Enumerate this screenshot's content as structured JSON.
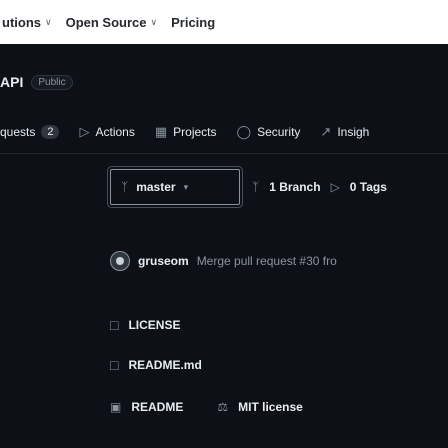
{
  "topnav": {
    "items": [
      {
        "label": "utions",
        "chevron": true
      },
      {
        "label": "Open Source",
        "chevron": true
      },
      {
        "label": "Pricing",
        "chevron": false
      }
    ]
  },
  "repo": {
    "name_fragment": "API",
    "visibility": "Public"
  },
  "tabs": [
    {
      "label": "quests",
      "counter": "2",
      "icon": ""
    },
    {
      "label": "Actions",
      "icon": "actions-icon"
    },
    {
      "label": "Projects",
      "icon": "projects-icon"
    },
    {
      "label": "Security",
      "icon": "security-icon"
    },
    {
      "label": "Insigh",
      "icon": "insights-icon"
    }
  ],
  "branch": {
    "current": "master",
    "branch_count_label": "1 Branch",
    "tag_count_label": "0 Tags"
  },
  "commit": {
    "author": "gruseom",
    "message": "Merge pull request #30 fro"
  },
  "files": [
    {
      "name": "LICENSE",
      "icon": "file-icon"
    },
    {
      "name": "README.md",
      "icon": "file-icon"
    }
  ],
  "footer": {
    "readme_label": "README",
    "license_label": "MIT license"
  },
  "colors": {
    "background": "#0d1117",
    "text": "#e6edf3",
    "muted": "#8b949e",
    "border": "#30363d"
  }
}
